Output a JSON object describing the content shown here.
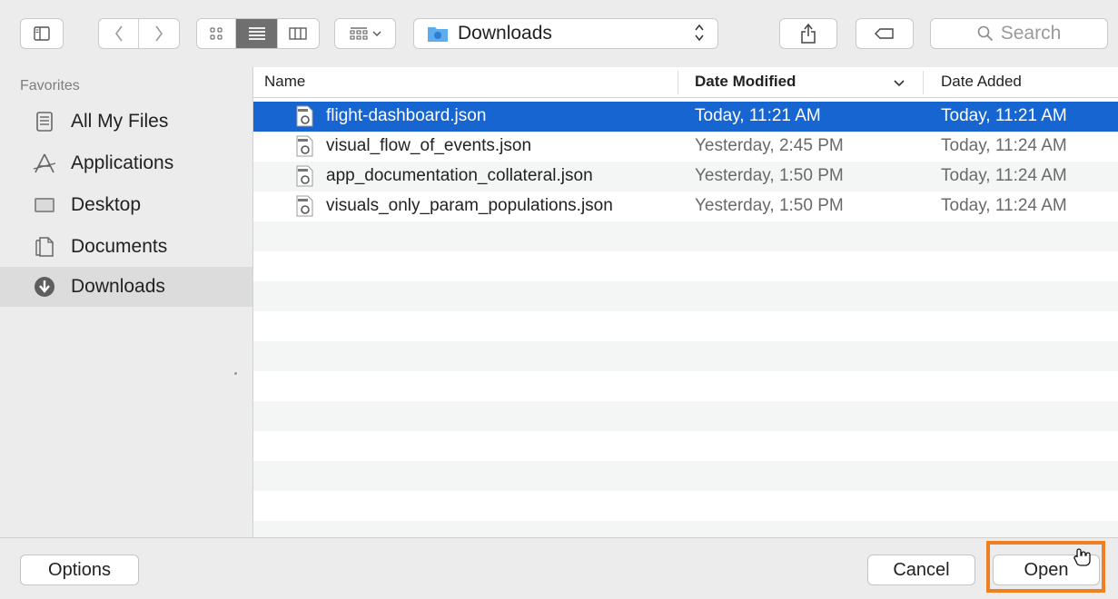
{
  "toolbar": {
    "path_label": "Downloads",
    "search_placeholder": "Search",
    "view_mode": "list"
  },
  "sidebar": {
    "header": "Favorites",
    "items": [
      {
        "label": "All My Files",
        "icon": "all-files-icon"
      },
      {
        "label": "Applications",
        "icon": "applications-icon"
      },
      {
        "label": "Desktop",
        "icon": "desktop-icon"
      },
      {
        "label": "Documents",
        "icon": "documents-icon"
      },
      {
        "label": "Downloads",
        "icon": "downloads-icon",
        "selected": true
      }
    ]
  },
  "list": {
    "columns": {
      "name": "Name",
      "date_modified": "Date Modified",
      "date_added": "Date Added"
    },
    "files": [
      {
        "name": "flight-dashboard.json",
        "modified": "Today, 11:21 AM",
        "added": "Today, 11:21 AM",
        "selected": true
      },
      {
        "name": "visual_flow_of_events.json",
        "modified": "Yesterday, 2:45 PM",
        "added": "Today, 11:24 AM"
      },
      {
        "name": "app_documentation_collateral.json",
        "modified": "Yesterday, 1:50 PM",
        "added": "Today, 11:24 AM"
      },
      {
        "name": "visuals_only_param_populations.json",
        "modified": "Yesterday, 1:50 PM",
        "added": "Today, 11:24 AM"
      }
    ]
  },
  "footer": {
    "options_label": "Options",
    "cancel_label": "Cancel",
    "open_label": "Open"
  },
  "colors": {
    "selection": "#1765d1",
    "highlight": "#f07f1f"
  }
}
